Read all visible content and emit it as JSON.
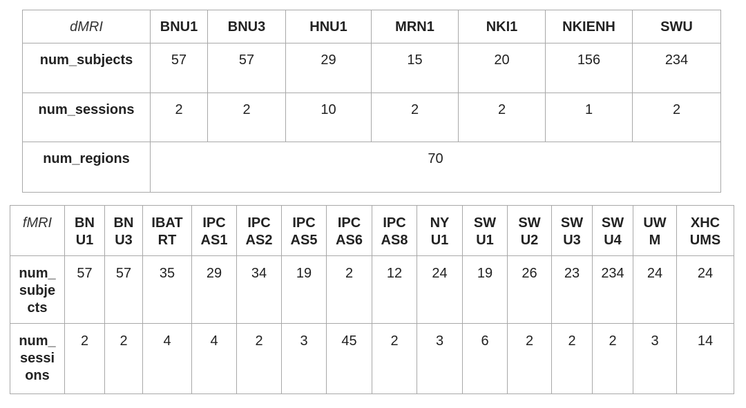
{
  "dmri": {
    "corner": "dMRI",
    "columns": [
      "BNU1",
      "BNU3",
      "HNU1",
      "MRN1",
      "NKI1",
      "NKIENH",
      "SWU"
    ],
    "rows": [
      {
        "label": "num_subjects",
        "values": [
          "57",
          "57",
          "29",
          "15",
          "20",
          "156",
          "234"
        ]
      },
      {
        "label": "num_sessions",
        "values": [
          "2",
          "2",
          "10",
          "2",
          "2",
          "1",
          "2"
        ]
      }
    ],
    "regions": {
      "label": "num_regions",
      "value": "70"
    }
  },
  "fmri": {
    "corner": "fMRI",
    "columns": [
      [
        "BN",
        "U1"
      ],
      [
        "BN",
        "U3"
      ],
      [
        "IBAT",
        "RT"
      ],
      [
        "IPC",
        "AS1"
      ],
      [
        "IPC",
        "AS2"
      ],
      [
        "IPC",
        "AS5"
      ],
      [
        "IPC",
        "AS6"
      ],
      [
        "IPC",
        "AS8"
      ],
      [
        "NY",
        "U1"
      ],
      [
        "SW",
        "U1"
      ],
      [
        "SW",
        "U2"
      ],
      [
        "SW",
        "U3"
      ],
      [
        "SW",
        "U4"
      ],
      [
        "UW",
        "M"
      ],
      [
        "XHC",
        "UMS"
      ]
    ],
    "rows": [
      {
        "label": [
          "num_",
          "subje",
          "cts"
        ],
        "values": [
          "57",
          "57",
          "35",
          "29",
          "34",
          "19",
          "2",
          "12",
          "24",
          "19",
          "26",
          "23",
          "234",
          "24",
          "24"
        ]
      },
      {
        "label": [
          "num_",
          "sessi",
          "ons"
        ],
        "values": [
          "2",
          "2",
          "4",
          "4",
          "2",
          "3",
          "45",
          "2",
          "3",
          "6",
          "2",
          "2",
          "2",
          "3",
          "14"
        ]
      }
    ]
  }
}
